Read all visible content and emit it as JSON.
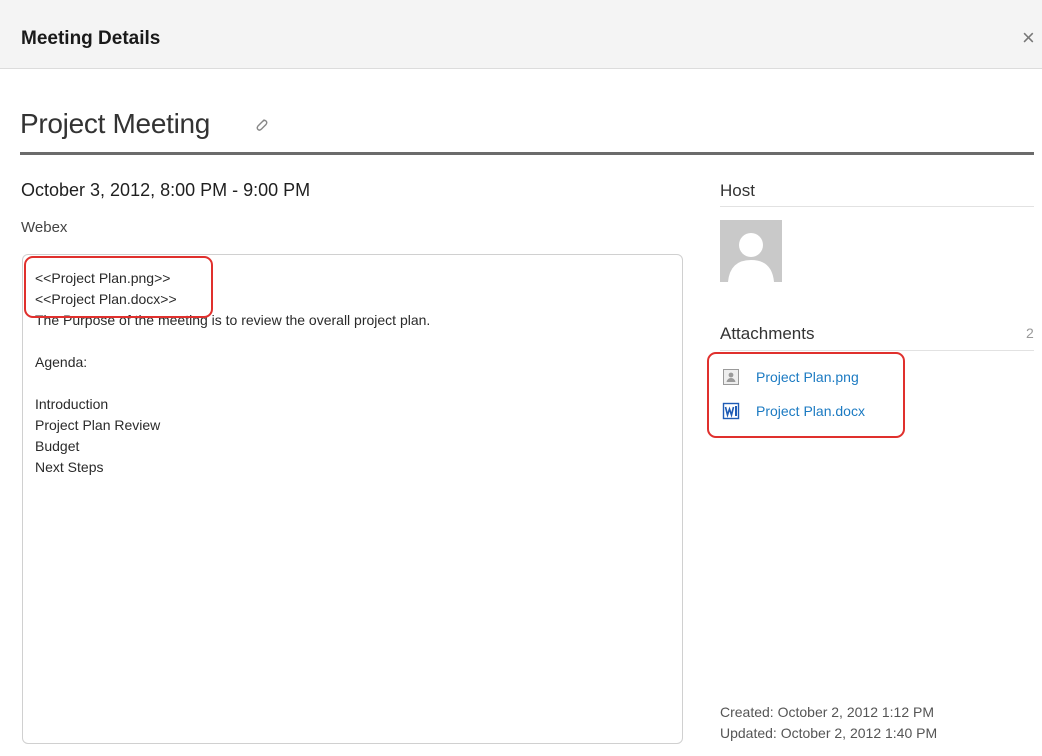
{
  "header": {
    "title": "Meeting Details",
    "close_glyph": "×"
  },
  "meeting": {
    "title": "Project Meeting",
    "date_time": "October 3, 2012, 8:00 PM - 9:00 PM",
    "location": "Webex",
    "description_lines": [
      "<<Project Plan.png>>",
      "<<Project Plan.docx>>",
      "The Purpose of the meeting is to review the overall project plan.",
      "",
      "Agenda:",
      "",
      "Introduction",
      "Project Plan Review",
      "Budget",
      "Next Steps"
    ]
  },
  "sidebar": {
    "host_heading": "Host",
    "attachments_heading": "Attachments",
    "attachments_count": "2",
    "attachments": [
      {
        "name": "Project Plan.png",
        "icon": "image-file-icon"
      },
      {
        "name": "Project Plan.docx",
        "icon": "word-file-icon"
      }
    ],
    "created": "Created: October 2, 2012 1:12 PM",
    "updated": "Updated: October 2, 2012 1:40 PM"
  },
  "colors": {
    "link": "#1b7ac2",
    "highlight": "#e0302d",
    "header_bg": "#f4f4f4"
  }
}
